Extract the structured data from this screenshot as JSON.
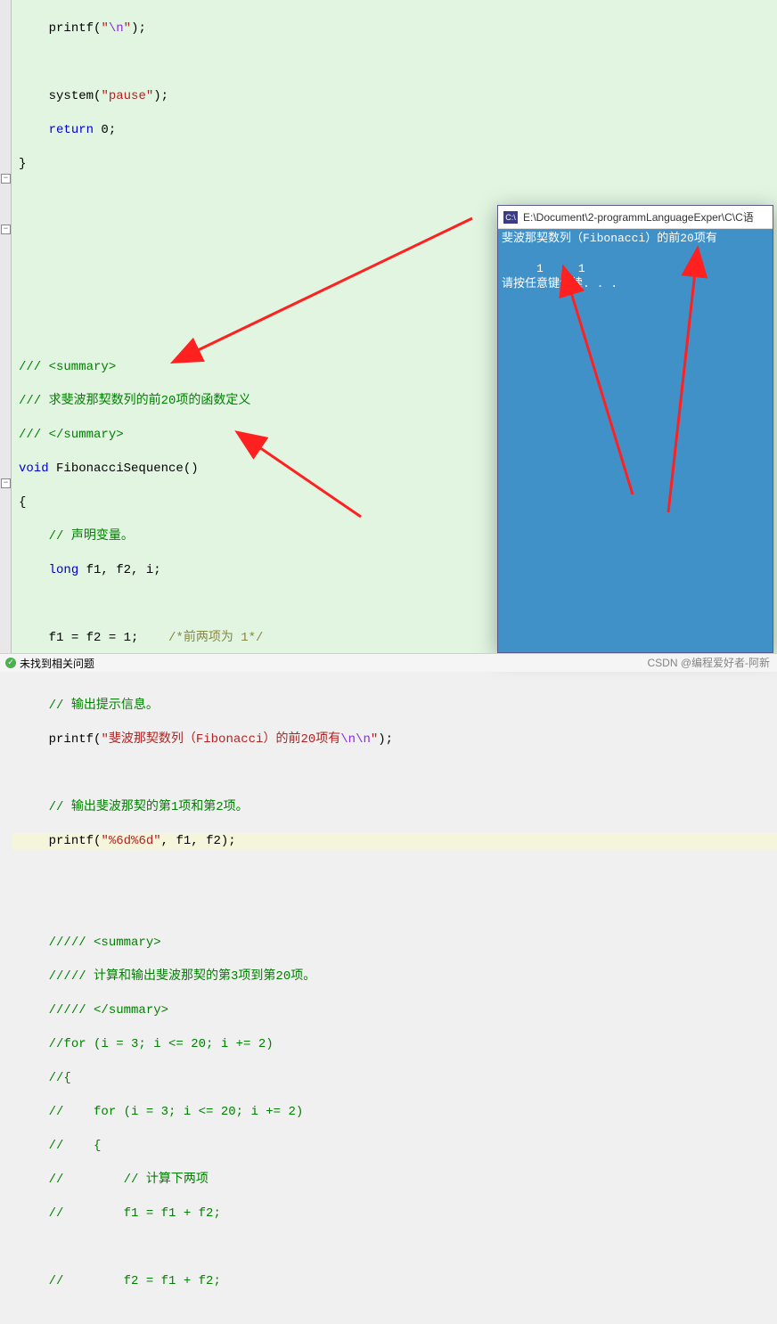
{
  "code": {
    "l1": "printf",
    "l1s": "\"",
    "l1e": "\\n",
    "l1s2": "\"",
    "l1end": ");",
    "l3a": "system",
    "l3b": "(",
    "l3c": "\"pause\"",
    "l3d": ");",
    "l4a": "return",
    "l4b": " 0;",
    "l5": "}",
    "l8a": "/// <summary>",
    "l8b": "/// 求斐波那契数列的前20项的函数定义",
    "l8c": "/// </summary>",
    "l9a": "void",
    "l9b": " FibonacciSequence()",
    "l10": "{",
    "l11": "// 声明变量。",
    "l12a": "long",
    "l12b": " f1, f2, i;",
    "l14": "f1 = f2 = 1;    ",
    "l14b": "/*前两项为 1*/",
    "l16": "// 输出提示信息。",
    "l17a": "printf",
    "l17b": "(",
    "l17c": "\"斐波那契数列（Fibonacci）的前20项有",
    "l17d": "\\n\\n",
    "l17e": "\"",
    "l17f": ");",
    "l19": "// 输出斐波那契的第1项和第2项。",
    "l20a": "printf",
    "l20b": "(",
    "l20c": "\"%6d%6d\"",
    "l20d": ", f1, f2);",
    "l22a": "///// <summary>",
    "l22b": "///// 计算和输出斐波那契的第3项到第20项。",
    "l22c": "///// </summary>",
    "l23": "//for (i = 3; i <= 20; i += 2)",
    "l24": "//{",
    "l25": "//    for (i = 3; i <= 20; i += 2)",
    "l26": "//    {",
    "l27": "//        // 计算下两项",
    "l28": "//        f1 = f1 + f2;",
    "l30": "//        f2 = f1 + f2;"
  },
  "console": {
    "title_prefix": "E:\\Document\\2-programmLanguageExper\\C\\C语",
    "line1": "斐波那契数列（Fibonacci）的前20项有",
    "line3": "     1     1",
    "line4": "请按任意键继续. . ."
  },
  "status": {
    "text": "未找到相关问题"
  },
  "watermark": "CSDN @编程爱好者-阿新"
}
